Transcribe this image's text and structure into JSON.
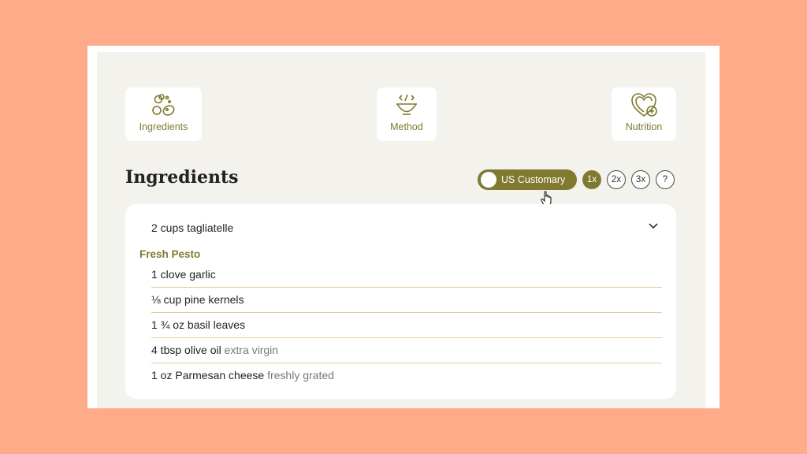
{
  "nav": {
    "ingredients_label": "Ingredients",
    "method_label": "Method",
    "nutrition_label": "Nutrition"
  },
  "section_title": "Ingredients",
  "units_toggle": {
    "label": "US Customary"
  },
  "servings": [
    "1x",
    "2x",
    "3x"
  ],
  "help_label": "?",
  "ingredients": {
    "top_item": "2 cups tagliatelle",
    "group_title": "Fresh Pesto",
    "items": [
      {
        "text": "1 clove garlic",
        "note": ""
      },
      {
        "text": "⅛ cup pine kernels",
        "note": ""
      },
      {
        "text": "1 ¾ oz basil leaves",
        "note": ""
      },
      {
        "text": "4 tbsp olive oil",
        "note": "extra virgin"
      },
      {
        "text": "1 oz Parmesan cheese",
        "note": "freshly grated"
      }
    ]
  },
  "colors": {
    "accent": "#7f7a2f",
    "background": "#ffab8a",
    "panel": "#f4f2ec",
    "divider": "#e3cf95"
  }
}
